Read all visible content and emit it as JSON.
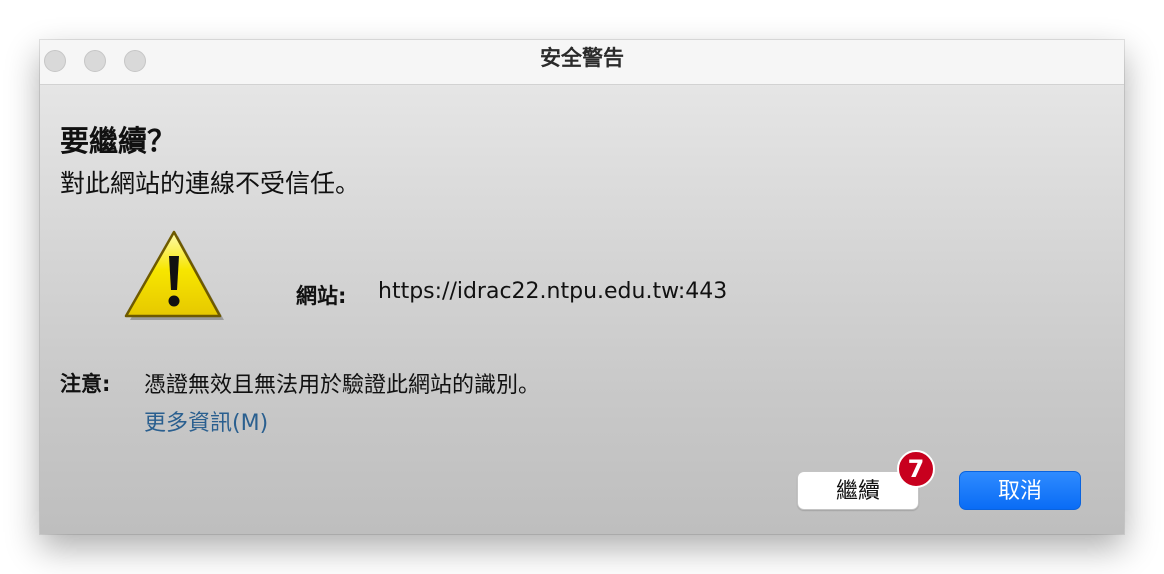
{
  "window": {
    "title": "安全警告"
  },
  "dialog": {
    "heading": "要繼續？",
    "subheading": "對此網站的連線不受信任。",
    "icon": "warning-triangle-icon",
    "site_label": "網站:",
    "site_url": "https://idrac22.ntpu.edu.tw:443",
    "note_label": "注意:",
    "note_text": "憑證無效且無法用於驗證此網站的識別。",
    "more_info_link": "更多資訊(M)"
  },
  "buttons": {
    "continue_label": "繼續",
    "cancel_label": "取消"
  },
  "annotation": {
    "step_number": "7"
  },
  "colors": {
    "link": "#2a5f8f",
    "primary_button": "#0a6cf5",
    "step_badge": "#c8001e",
    "warning_fill": "#f4e000"
  }
}
